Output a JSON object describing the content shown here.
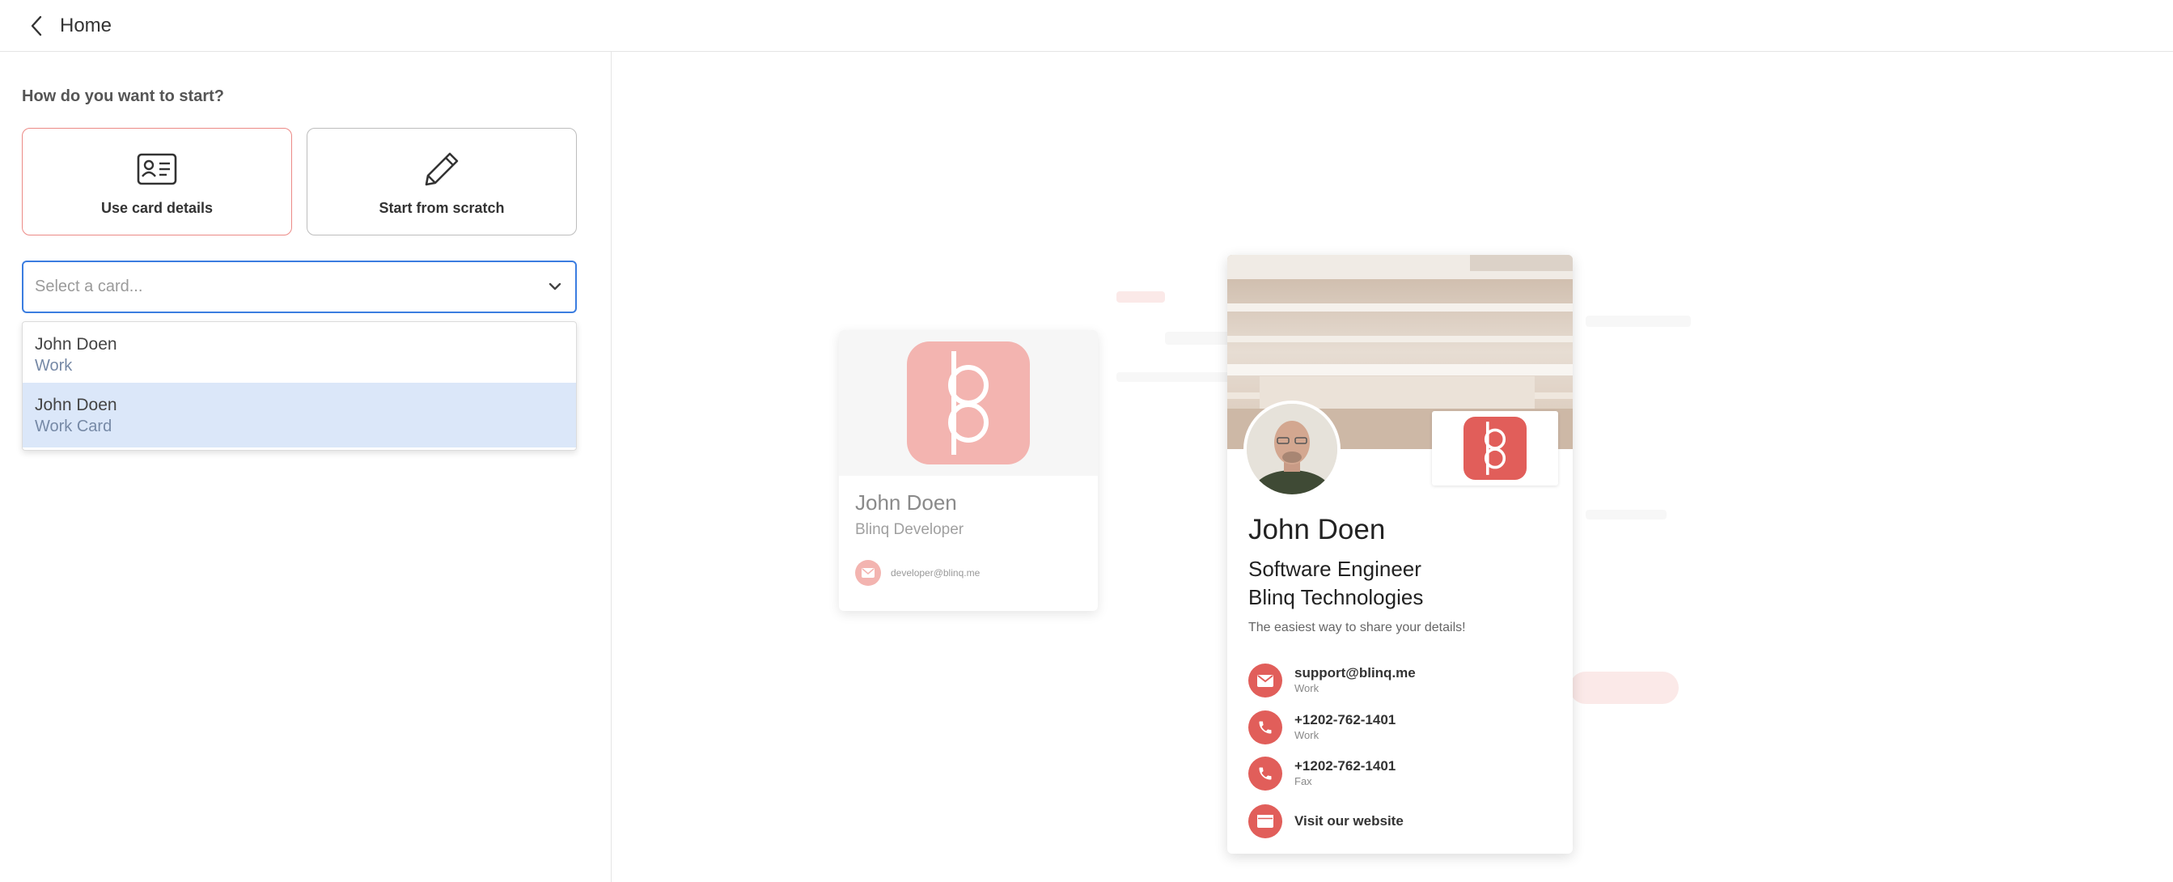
{
  "topbar": {
    "title": "Home"
  },
  "start": {
    "question": "How do you want to start?",
    "option_card": "Use card details",
    "option_scratch": "Start from scratch"
  },
  "select": {
    "placeholder": "Select a card...",
    "options": [
      {
        "name": "John Doen",
        "sub": "Work"
      },
      {
        "name": "John Doen",
        "sub": "Work Card"
      }
    ]
  },
  "mini_card": {
    "name": "John Doen",
    "role": "Blinq Developer",
    "email": "developer@blinq.me"
  },
  "card": {
    "name": "John Doen",
    "title": "Software Engineer",
    "company": "Blinq Technologies",
    "tagline": "The easiest way to share your details!",
    "contacts": [
      {
        "icon": "mail-icon",
        "value": "support@blinq.me",
        "label": "Work"
      },
      {
        "icon": "phone-icon",
        "value": "+1202-762-1401",
        "label": "Work"
      },
      {
        "icon": "phone-icon",
        "value": "+1202-762-1401",
        "label": "Fax"
      },
      {
        "icon": "website-icon",
        "value": "Visit our website",
        "label": ""
      }
    ]
  },
  "colors": {
    "brand": "#e15e5a",
    "brand_light": "#f3b4b0",
    "select_focus": "#3b7de0",
    "highlight": "#dbe7f9"
  }
}
